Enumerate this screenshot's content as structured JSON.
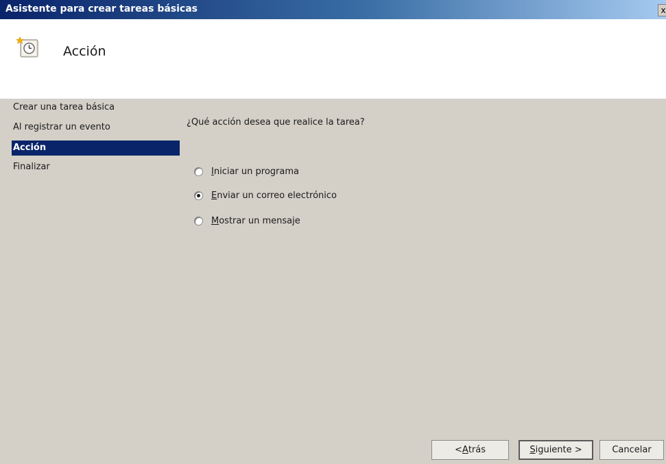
{
  "window": {
    "title": "Asistente para crear tareas básicas",
    "close_glyph": "x"
  },
  "header": {
    "title": "Acción",
    "icon": "task-clock-icon"
  },
  "nav": {
    "items": [
      {
        "label": "Crear una tarea básica",
        "active": false
      },
      {
        "label": "Al registrar un evento",
        "active": false
      },
      {
        "label": "Acción",
        "active": true
      },
      {
        "label": "Finalizar",
        "active": false
      }
    ]
  },
  "main": {
    "question": "¿Qué acción desea que realice la tarea?",
    "options": [
      {
        "mnemonic": "I",
        "rest": "niciar un programa",
        "checked": false
      },
      {
        "mnemonic": "E",
        "rest": "nviar un correo electrónico",
        "checked": true
      },
      {
        "mnemonic": "M",
        "rest": "ostrar un mensaje",
        "checked": false
      }
    ]
  },
  "buttons": {
    "back": {
      "prefix": "< ",
      "mnemonic": "A",
      "rest": "trás"
    },
    "next": {
      "mnemonic": "S",
      "rest": "iguiente >"
    },
    "cancel": {
      "label": "Cancelar"
    }
  },
  "colors": {
    "selection": "#0a246a",
    "dialog_background": "#d4d0c8",
    "header_background": "#ffffff"
  }
}
